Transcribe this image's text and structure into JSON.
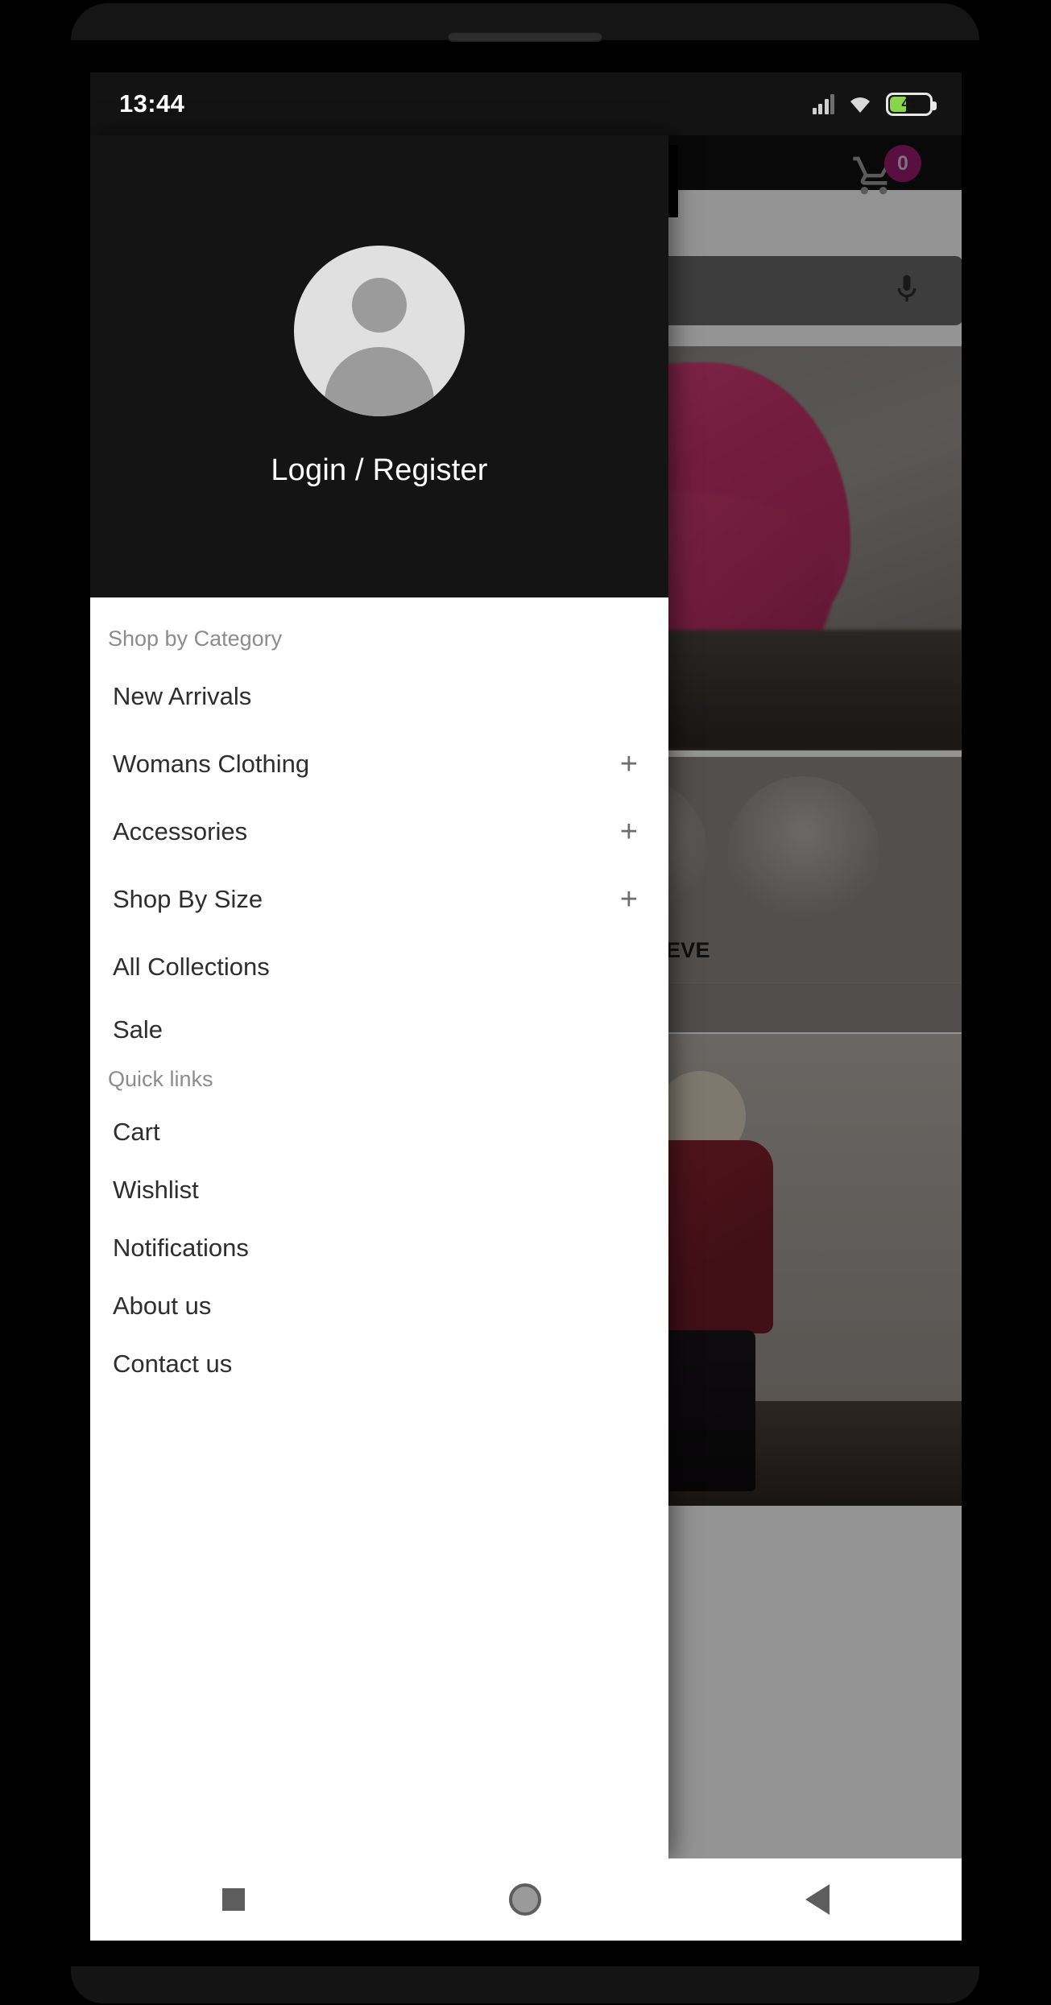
{
  "status_bar": {
    "time": "13:44",
    "battery_percent": "41",
    "signal_icon": "cellular-signal-icon",
    "wifi_icon": "wifi-icon",
    "battery_icon": "battery-icon"
  },
  "app": {
    "cart_badge_count": "0",
    "cart_icon": "shopping-cart-icon",
    "search_placeholder": "",
    "search_value": "",
    "mic_icon": "microphone-icon",
    "category_label": "LONG+SLEEVE"
  },
  "drawer": {
    "avatar_icon": "user-avatar-icon",
    "login_label": "Login / Register",
    "sections": [
      {
        "title": "Shop by Category",
        "items": [
          {
            "label": "New Arrivals",
            "expandable": false,
            "expand_glyph": ""
          },
          {
            "label": "Womans Clothing",
            "expandable": true,
            "expand_glyph": "+"
          },
          {
            "label": "Accessories",
            "expandable": true,
            "expand_glyph": "+"
          },
          {
            "label": "Shop By Size",
            "expandable": true,
            "expand_glyph": "+"
          },
          {
            "label": "All Collections",
            "expandable": false,
            "expand_glyph": ""
          },
          {
            "label": "Sale",
            "expandable": false,
            "expand_glyph": ""
          }
        ]
      },
      {
        "title": "Quick links",
        "items": [
          {
            "label": "Cart",
            "expandable": false,
            "expand_glyph": ""
          },
          {
            "label": "Wishlist",
            "expandable": false,
            "expand_glyph": ""
          },
          {
            "label": "Notifications",
            "expandable": false,
            "expand_glyph": ""
          },
          {
            "label": "About us",
            "expandable": false,
            "expand_glyph": ""
          },
          {
            "label": "Contact us",
            "expandable": false,
            "expand_glyph": ""
          }
        ]
      }
    ]
  },
  "system_nav": {
    "recents_icon": "square-recents-icon",
    "home_icon": "circle-home-icon",
    "back_icon": "triangle-back-icon"
  },
  "colors": {
    "badge": "#9c1a71",
    "drawer_header": "#141414",
    "battery_green": "#8ad44a"
  }
}
